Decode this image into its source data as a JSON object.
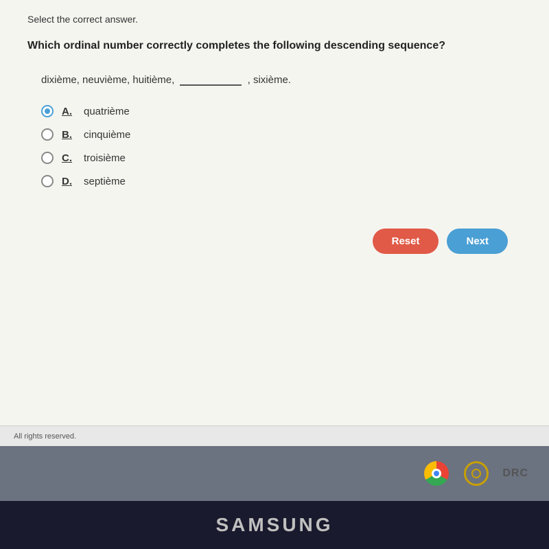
{
  "page": {
    "instruction": "Select the correct answer.",
    "question": "Which ordinal number correctly completes the following descending sequence?",
    "sequence": {
      "before": "dixième, neuvième, huitième,",
      "blank": "",
      "after": ", sixième."
    },
    "options": [
      {
        "id": "A",
        "text": "quatrième",
        "selected": true
      },
      {
        "id": "B",
        "text": "cinquième",
        "selected": false
      },
      {
        "id": "C",
        "text": "troisième",
        "selected": false
      },
      {
        "id": "D",
        "text": "septième",
        "selected": false
      }
    ],
    "buttons": {
      "reset": "Reset",
      "next": "Next"
    },
    "footer": "All rights reserved.",
    "samsung": "SAMSUNG",
    "drc": "DRC"
  }
}
